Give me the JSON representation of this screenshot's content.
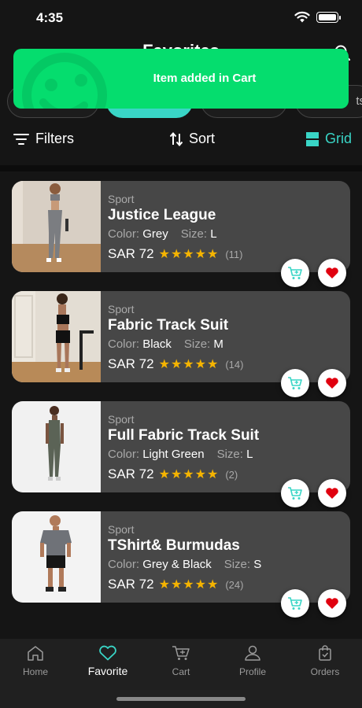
{
  "status_bar": {
    "time": "4:35"
  },
  "header": {
    "title": "Favorites"
  },
  "chips": [
    {
      "label": ""
    },
    {
      "label": "",
      "active": true
    },
    {
      "label": ""
    },
    {
      "label": "ts"
    }
  ],
  "toast": {
    "message": "Item added in Cart",
    "color": "#05dd6e"
  },
  "toolbar": {
    "filters": "Filters",
    "sort": "Sort",
    "grid": "Grid",
    "accent": "#39d5c6"
  },
  "products": [
    {
      "category": "Sport",
      "name": "Justice League",
      "color_label": "Color:",
      "color": "Grey",
      "size_label": "Size:",
      "size": "L",
      "price": "SAR 72",
      "rating": 5,
      "stars": "★★★★★",
      "reviews": "(11)",
      "favorited": true
    },
    {
      "category": "Sport",
      "name": "Fabric Track Suit",
      "color_label": "Color:",
      "color": "Black",
      "size_label": "Size:",
      "size": "M",
      "price": "SAR 72",
      "rating": 5,
      "stars": "★★★★★",
      "reviews": "(14)",
      "favorited": true
    },
    {
      "category": "Sport",
      "name": "Full Fabric Track Suit",
      "color_label": "Color:",
      "color": "Light Green",
      "size_label": "Size:",
      "size": "L",
      "price": "SAR 72",
      "rating": 5,
      "stars": "★★★★★",
      "reviews": "(2)",
      "favorited": true
    },
    {
      "category": "Sport",
      "name": "TShirt& Burmudas",
      "color_label": "Color:",
      "color": "Grey & Black",
      "size_label": "Size:",
      "size": "S",
      "price": "SAR 72",
      "rating": 5,
      "stars": "★★★★★",
      "reviews": "(24)",
      "favorited": true
    }
  ],
  "bottom_nav": [
    {
      "label": "Home",
      "icon": "home-icon"
    },
    {
      "label": "Favorite",
      "icon": "heart-icon",
      "active": true
    },
    {
      "label": "Cart",
      "icon": "cart-icon"
    },
    {
      "label": "Profile",
      "icon": "profile-icon"
    },
    {
      "label": "Orders",
      "icon": "orders-icon"
    }
  ]
}
